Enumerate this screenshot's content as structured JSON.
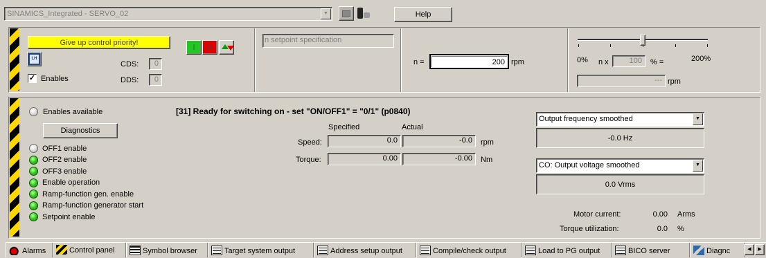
{
  "toolbar": {
    "drive_select": "SINAMICS_Integrated - SERVO_02",
    "help_label": "Help"
  },
  "control": {
    "priority_button": "Give up control priority!",
    "on_button": "I",
    "off_button": "0",
    "enables_label": "Enables",
    "enables_checked": true,
    "cds_label": "CDS:",
    "cds_value": "0",
    "dds_label": "DDS:",
    "dds_value": "0",
    "setpoint_spec": "n setpoint specification",
    "n_label": "n =",
    "n_value": "200",
    "n_unit": "rpm",
    "slider_min": "0%",
    "slider_max": "200%",
    "slider_level_percent": 100,
    "n_x_label": "n x",
    "percent_value": "100",
    "percent_eq": "% =",
    "rpm_value": "---",
    "rpm_unit": "rpm"
  },
  "status": {
    "enables_available": "Enables available",
    "diagnostics_button": "Diagnostics",
    "message": "[31] Ready for switching on - set \"ON/OFF1\" = \"0/1\" (p0840)",
    "enable_items": [
      {
        "label": "OFF1 enable",
        "state": "off"
      },
      {
        "label": "OFF2 enable",
        "state": "on"
      },
      {
        "label": "OFF3 enable",
        "state": "on"
      },
      {
        "label": "Enable operation",
        "state": "on"
      },
      {
        "label": "Ramp-function gen. enable",
        "state": "on"
      },
      {
        "label": "Ramp-function generator start",
        "state": "on"
      },
      {
        "label": "Setpoint enable",
        "state": "on"
      }
    ]
  },
  "values": {
    "specified_header": "Specified",
    "actual_header": "Actual",
    "speed_label": "Speed:",
    "speed_specified": "0.0",
    "speed_actual": "-0.0",
    "speed_unit": "rpm",
    "torque_label": "Torque:",
    "torque_specified": "0.00",
    "torque_actual": "-0.00",
    "torque_unit": "Nm"
  },
  "monitor": {
    "select1": "Output frequency smoothed",
    "value1": "-0.0 Hz",
    "select2": "CO: Output voltage smoothed",
    "value2": "0.0 Vrms",
    "motor_current_label": "Motor current:",
    "motor_current_value": "0.00",
    "motor_current_unit": "Arms",
    "torque_util_label": "Torque utilization:",
    "torque_util_value": "0.0",
    "torque_util_unit": "%"
  },
  "tabs": [
    {
      "label": "Alarms",
      "icon": "bomb-icon"
    },
    {
      "label": "Control panel",
      "icon": "hazard-icon"
    },
    {
      "label": "Symbol browser",
      "icon": "list-icon"
    },
    {
      "label": "Target system output",
      "icon": "grid-icon"
    },
    {
      "label": "Address setup output",
      "icon": "grid-icon"
    },
    {
      "label": "Compile/check output",
      "icon": "grid-icon"
    },
    {
      "label": "Load to PG output",
      "icon": "grid-icon"
    },
    {
      "label": "BICO server",
      "icon": "grid-icon"
    },
    {
      "label": "Diagnc",
      "icon": "diagnostics-icon"
    }
  ],
  "colors": {
    "background": "#d4d0c8",
    "priority_yellow": "#ffff00",
    "on_green": "#22c822",
    "off_red": "#e00000",
    "led_green": "#38d020"
  }
}
